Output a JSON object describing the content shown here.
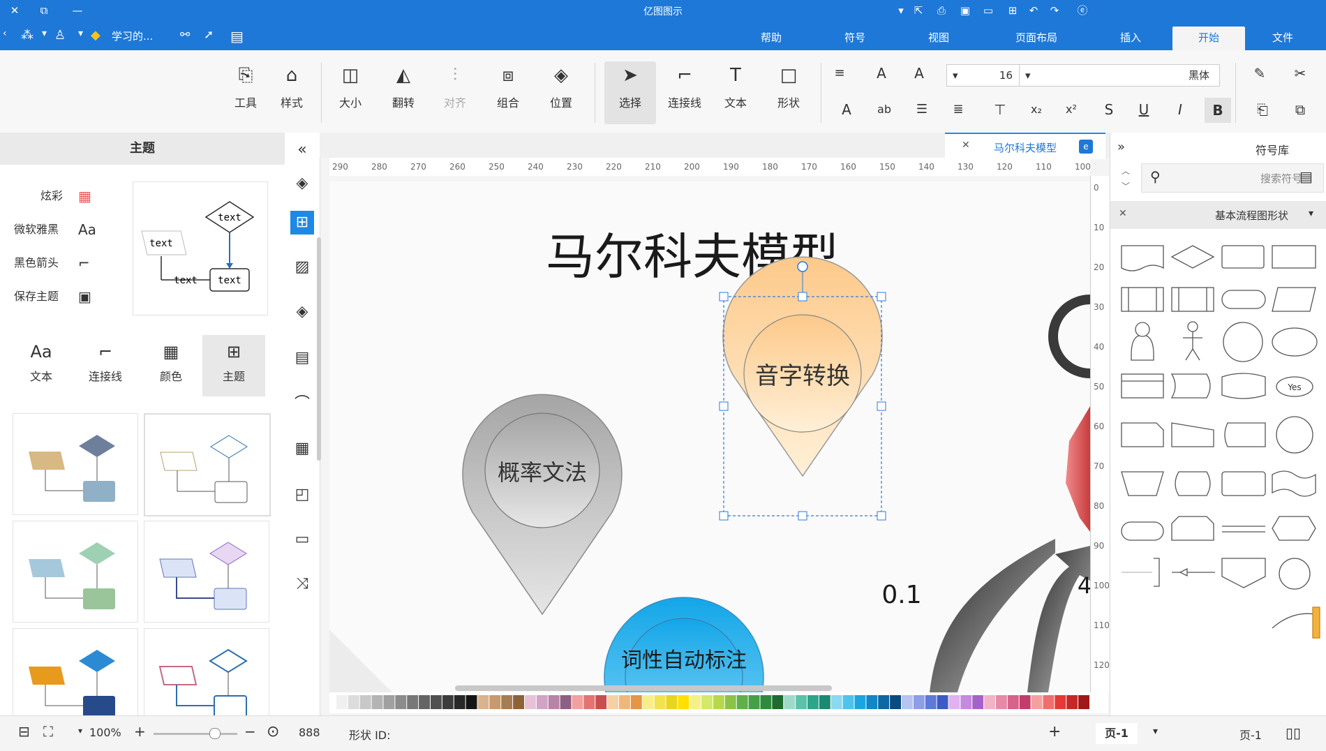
{
  "titlebar": {
    "title": "亿图图示"
  },
  "menubar": {
    "tabs": [
      "文件",
      "开始",
      "插入",
      "页面布局",
      "视图",
      "符号",
      "帮助"
    ],
    "active_tab": "开始",
    "quick_doc": "学习的...",
    "accent": "#1e78d7"
  },
  "ribbon": {
    "buttons": {
      "tools": "工具",
      "style": "样式",
      "size": "大小",
      "flip": "翻转",
      "align": "对齐",
      "group": "组合",
      "position": "位置",
      "select": "选择",
      "connector": "连接线",
      "text": "文本",
      "shape": "形状"
    },
    "font_name": "黑体",
    "font_size": "16"
  },
  "left_panel": {
    "header": "主题",
    "list": [
      "炫彩",
      "微软雅黑",
      "黑色箭头",
      "保存主题"
    ],
    "preview_text": "text",
    "tiles": [
      "主题",
      "颜色",
      "连接线",
      "文本"
    ],
    "active_tile": "主题"
  },
  "document": {
    "tab_label": "马尔科夫模型"
  },
  "canvas": {
    "ruler_h": [
      "290",
      "280",
      "270",
      "260",
      "250",
      "240",
      "230",
      "220",
      "210",
      "200",
      "190",
      "180",
      "170",
      "160",
      "150",
      "140",
      "130",
      "120",
      "110",
      "100"
    ],
    "ruler_v": [
      "0",
      "10",
      "20",
      "30",
      "40",
      "50",
      "60",
      "70",
      "80",
      "90",
      "100",
      "110",
      "120"
    ],
    "title": "马尔科夫模型",
    "pins": [
      {
        "label": "音字转换",
        "color_top": "#fdc98a",
        "color_bottom": "#fff0d8"
      },
      {
        "label": "概率文法",
        "color_top": "#a5a5a5",
        "color_bottom": "#e6e6e6"
      },
      {
        "label": "词性自动标注",
        "color_top": "#13a6e8",
        "color_bottom": "#7fd4f6"
      }
    ],
    "number_label": "0.1",
    "edge_label": "4"
  },
  "right_panel": {
    "header": "符号库",
    "search_placeholder": "搜索符号",
    "section": "基本流程图形状",
    "yes_label": "Yes"
  },
  "statusbar": {
    "page_label": "页-1",
    "page_tab": "页-1",
    "shape_id_label": "形状 ID:",
    "shape_id_value": "888",
    "zoom": "100%"
  }
}
